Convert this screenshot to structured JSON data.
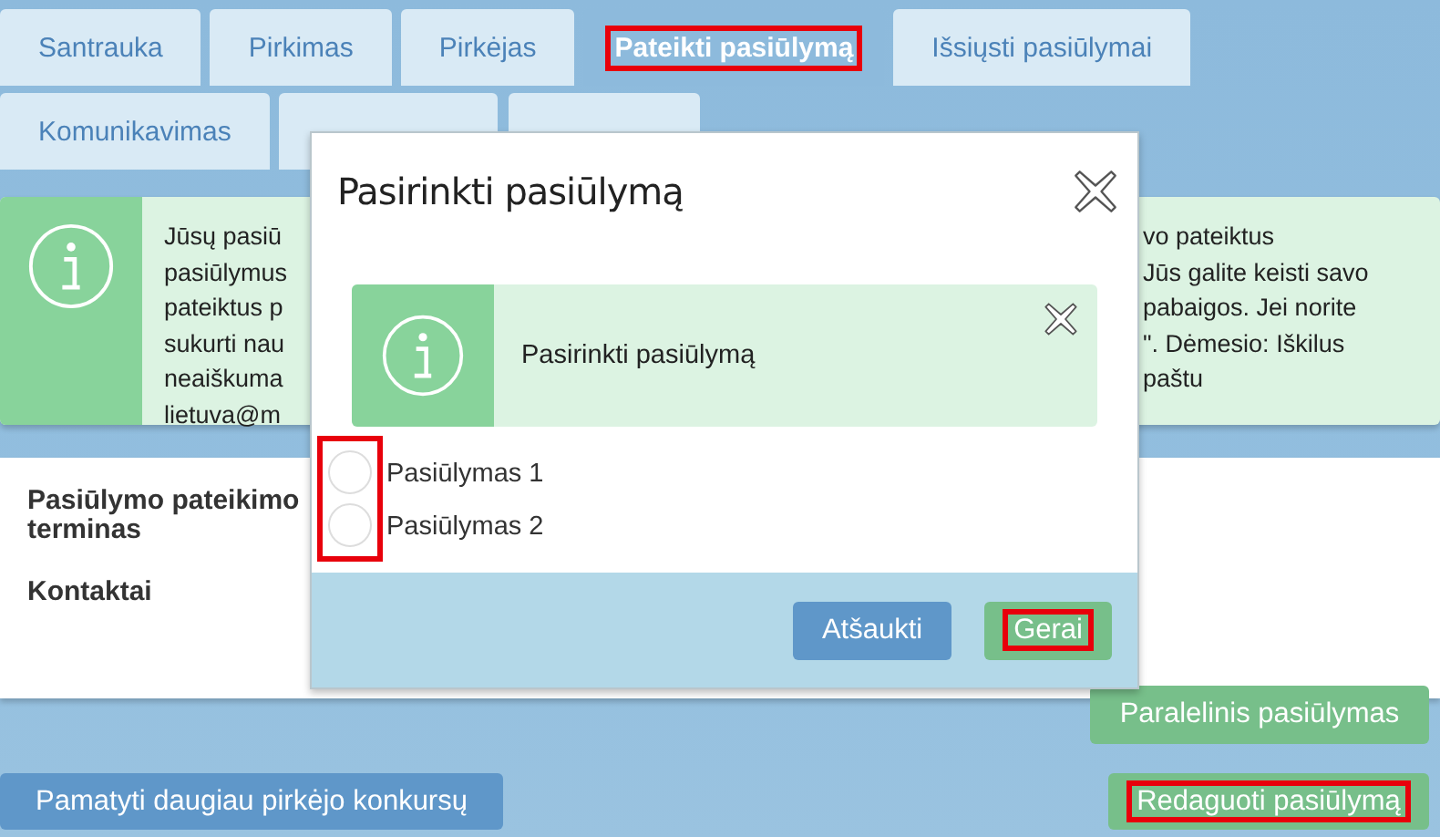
{
  "tabs": [
    {
      "label": "Santrauka",
      "selected": false,
      "highlighted": false
    },
    {
      "label": "Pirkimas",
      "selected": false,
      "highlighted": false
    },
    {
      "label": "Pirkėjas",
      "selected": false,
      "highlighted": false
    },
    {
      "label": "Pateikti pasiūlymą",
      "selected": true,
      "highlighted": true
    },
    {
      "label": "Išsiųsti pasiūlymai",
      "selected": false,
      "highlighted": false
    },
    {
      "label": "Komunikavimas",
      "selected": false,
      "highlighted": false
    }
  ],
  "info": {
    "left_lines": [
      "Jūsų pasiū",
      "pasiūlymus",
      "pateiktus p",
      "sukurti nau",
      "neaiškuma",
      "lietuva@m"
    ],
    "right_lines": [
      "vo pateiktus",
      "Jūs galite keisti savo",
      "pabaigos. Jei norite",
      "\". Dėmesio: Iškilus",
      "paštu"
    ]
  },
  "details": [
    "Pasiūlymo pateikimo terminas",
    "Kontaktai"
  ],
  "buttons": [
    {
      "label": "Paralelinis pasiūlymas",
      "kind": "green",
      "highlighted": false
    },
    {
      "label": "Pamatyti daugiau pirkėjo konkursų",
      "kind": "blue",
      "highlighted": false
    },
    {
      "label": "Redaguoti pasiūlymą",
      "kind": "green",
      "highlighted": true
    }
  ],
  "dialog": {
    "title": "Pasirinkti pasiūlymą",
    "alert": "Pasirinkti pasiūlymą",
    "options_highlighted": true,
    "options": [
      {
        "label": "Pasiūlymas 1",
        "selected": false
      },
      {
        "label": "Pasiūlymas 2",
        "selected": false
      }
    ],
    "buttons": [
      {
        "label": "Atšaukti",
        "kind": "blue",
        "highlighted": false
      },
      {
        "label": "Gerai",
        "kind": "green",
        "highlighted": true
      }
    ]
  }
}
